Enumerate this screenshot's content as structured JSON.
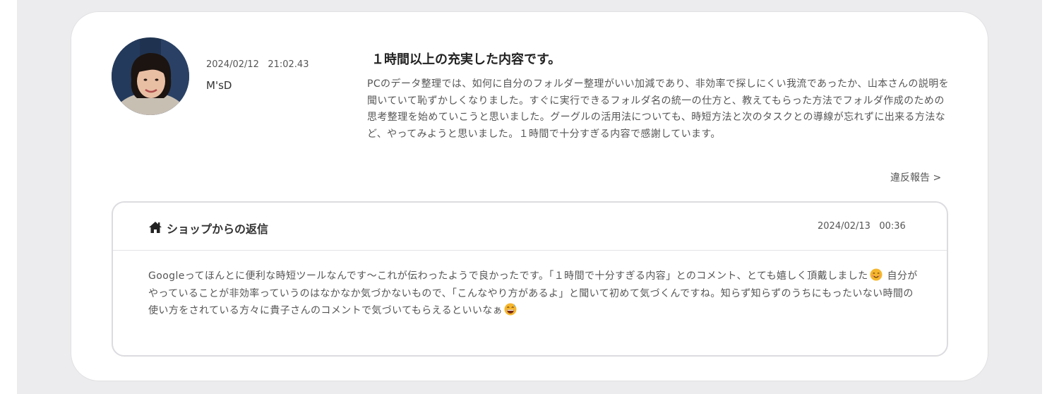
{
  "review": {
    "date": "2024/02/12   21:02.43",
    "reviewer": "M'sD",
    "title": "１時間以上の充実した内容です。",
    "body": "PCのデータ整理では、如何に自分のフォルダー整理がいい加減であり、非効率で探しにくい我流であったか、山本さんの説明を聞いていて恥ずかしくなりました。すぐに実行できるフォルダ名の統一の仕方と、教えてもらった方法でフォルダ作成のための思考整理を始めていこうと思いました。グーグルの活用法についても、時短方法と次のタスクとの導線が忘れずに出来る方法など、やってみようと思いました。１時間で十分すぎる内容で感謝しています。",
    "report_label": "違反報告 >"
  },
  "reply": {
    "icon": "home-icon",
    "title": "ショップからの返信",
    "date": "2024/02/13   00:36",
    "body_part1": "Googleってほんとに便利な時短ツールなんです〜これが伝わったようで良かったです。「１時間で十分すぎる内容」とのコメント、とても嬉しく頂戴しました",
    "emoji1": "smiling-face-emoji",
    "body_part2": " 自分がやっていることが非効率っていうのはなかなか気づかないもので、「こんなやり方があるよ」と聞いて初めて気づくんですね。知らず知らずのうちにもったいない時間の使い方をされている方々に貴子さんのコメントで気づいてもらえるといいなぁ",
    "emoji2": "grinning-sweat-face-emoji"
  },
  "colors": {
    "page_band": "#ececee",
    "card": "#ffffff",
    "border": "#dcdce0",
    "text": "#555555",
    "emoji_yellow": "#f5b62d"
  }
}
